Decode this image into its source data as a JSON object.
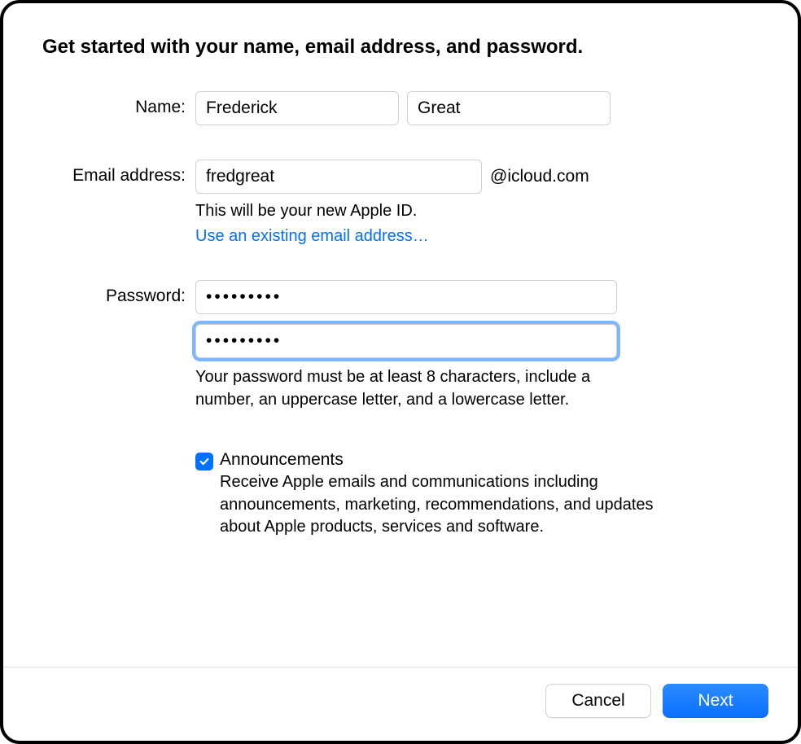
{
  "heading": "Get started with your name, email address, and password.",
  "form": {
    "name": {
      "label": "Name:",
      "first_value": "Frederick",
      "last_value": "Great"
    },
    "email": {
      "label": "Email address:",
      "value": "fredgreat",
      "suffix": "@icloud.com",
      "helper": "This will be your new Apple ID.",
      "link": "Use an existing email address…"
    },
    "password": {
      "label": "Password:",
      "value": "•••••••••",
      "confirm_value": "•••••••••",
      "helper": "Your password must be at least 8 characters, include a number, an uppercase letter, and a lowercase letter."
    },
    "announcements": {
      "checked": true,
      "title": "Announcements",
      "desc": "Receive Apple emails and communications including announcements, marketing, recommendations, and updates about Apple products, services and software."
    }
  },
  "footer": {
    "cancel": "Cancel",
    "next": "Next"
  }
}
